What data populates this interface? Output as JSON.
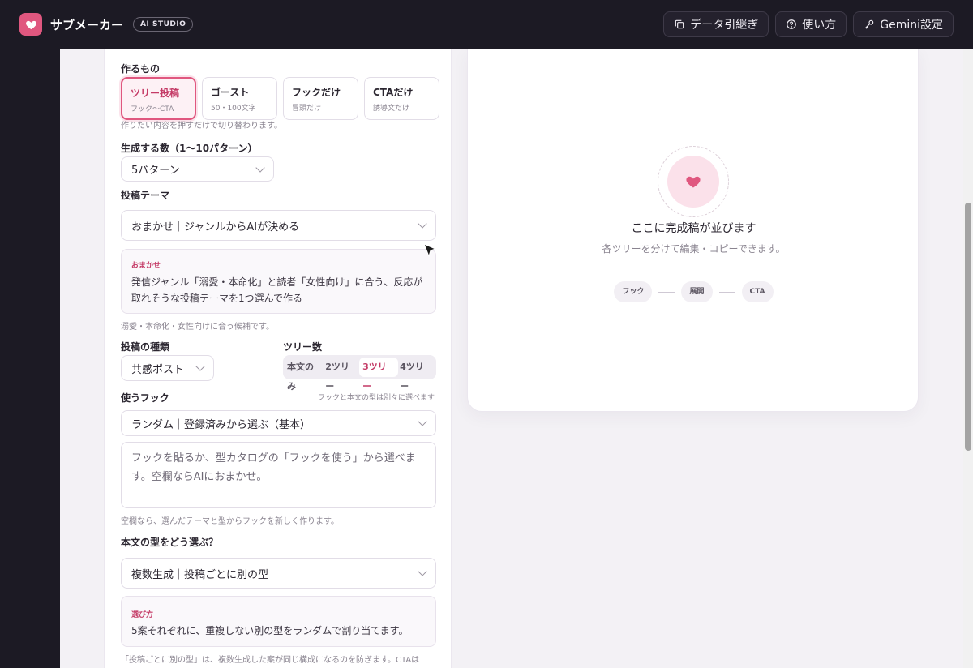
{
  "app": {
    "name": "サブメーカー",
    "badge": "AI STUDIO"
  },
  "header": {
    "buttons": [
      {
        "label": "データ引継ぎ",
        "icon": "copy-icon"
      },
      {
        "label": "使い方",
        "icon": "help-circle-icon"
      },
      {
        "label": "Gemini設定",
        "icon": "key-icon"
      }
    ]
  },
  "form": {
    "make_label": "作るもの",
    "types": [
      {
        "title": "ツリー投稿",
        "sub": "フック〜CTA",
        "active": true
      },
      {
        "title": "ゴースト",
        "sub": "50・100文字",
        "active": false
      },
      {
        "title": "フックだけ",
        "sub": "冒頭だけ",
        "active": false
      },
      {
        "title": "CTAだけ",
        "sub": "誘導文だけ",
        "active": false
      }
    ],
    "make_hint": "作りたい内容を押すだけで切り替わります。",
    "count_label": "生成する数（1〜10パターン）",
    "count_value": "5パターン",
    "theme_label": "投稿テーマ",
    "theme_value": "おまかせ｜ジャンルからAIが決める",
    "theme_info_tag": "おまかせ",
    "theme_info_body": "発信ジャンル「溺愛・本命化」と読者「女性向け」に合う、反応が取れそうな投稿テーマを1つ選んで作る",
    "theme_hint": "溺愛・本命化・女性向けに合う候補です。",
    "post_type_label": "投稿の種類",
    "post_type_value": "共感ポスト",
    "tree_count_label": "ツリー数",
    "tree_options": [
      "本文のみ",
      "2ツリー",
      "3ツリー",
      "4ツリー"
    ],
    "tree_selected": "3ツリー",
    "hook_label": "使うフック",
    "hook_side_hint": "フックと本文の型は別々に選べます",
    "hook_value": "ランダム｜登録済みから選ぶ（基本）",
    "hook_placeholder": "フックを貼るか、型カタログの「フックを使う」から選べます。空欄ならAIにおまかせ。",
    "hook_hint": "空欄なら、選んだテーマと型からフックを新しく作ります。",
    "body_type_label": "本文の型をどう選ぶ？",
    "body_type_value": "複数生成｜投稿ごとに別の型",
    "body_info_tag": "選び方",
    "body_info_body": "5案それぞれに、重複しない別の型をランダムで割り当てます。",
    "body_hint": "「投稿ごとに別の型」は、複数生成した案が同じ構成になるのを防ぎます。CTAは"
  },
  "result": {
    "empty_title": "ここに完成稿が並びます",
    "empty_sub": "各ツリーを分けて編集・コピーできます。",
    "steps": [
      "フック",
      "展開",
      "CTA"
    ]
  },
  "colors": {
    "accent": "#e0577f",
    "topbar": "#1c1a24"
  }
}
